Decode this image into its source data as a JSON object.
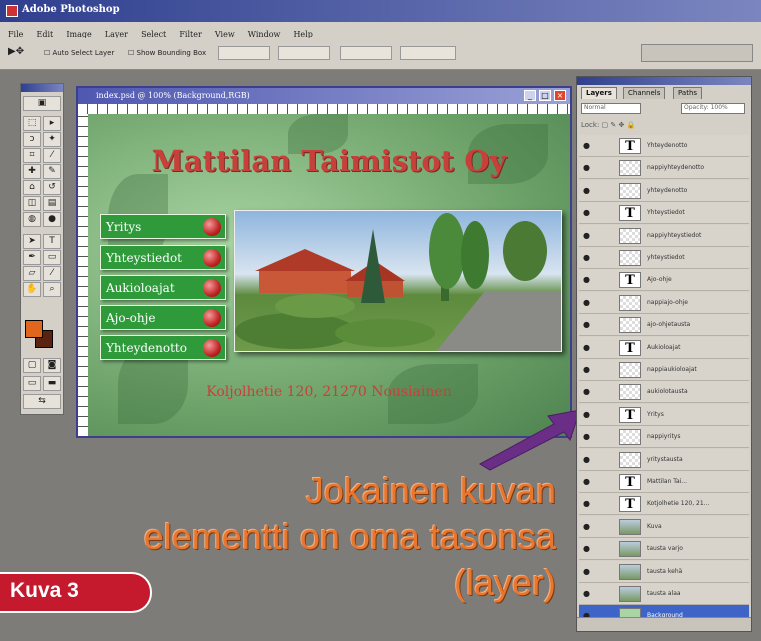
{
  "app": {
    "title": "Adobe Photoshop"
  },
  "menu": [
    "File",
    "Edit",
    "Image",
    "Layer",
    "Select",
    "Filter",
    "View",
    "Window",
    "Help"
  ],
  "options_bar": {
    "auto_select": "Auto Select Layer",
    "bounding_box": "Show Bounding Box"
  },
  "document": {
    "title": "index.psd @ 100% (Background,RGB)",
    "heading": "Mattilan Taimistot Oy",
    "nav": [
      "Yritys",
      "Yhteystiedot",
      "Aukioloajat",
      "Ajo-ohje",
      "Yhteydenotto"
    ],
    "address": "Koljolhetie 120, 21270 Nousiainen"
  },
  "layers_panel": {
    "tabs": [
      "Layers",
      "Channels",
      "Paths"
    ],
    "mode": "Normal",
    "opacity": "Opacity: 100%",
    "lock": "Lock:",
    "rows": [
      {
        "name": "Yhteydenotto",
        "type": "T"
      },
      {
        "name": "nappiyhteydenotto",
        "type": "px"
      },
      {
        "name": "yhteydenotto",
        "type": "px"
      },
      {
        "name": "Yhteystiedot",
        "type": "T"
      },
      {
        "name": "nappiyhteystiedot",
        "type": "px"
      },
      {
        "name": "yhteystiedot",
        "type": "px"
      },
      {
        "name": "Ajo-ohje",
        "type": "T"
      },
      {
        "name": "nappiajo-ohje",
        "type": "px"
      },
      {
        "name": "ajo-ohjetausta",
        "type": "px"
      },
      {
        "name": "Aukioloajat",
        "type": "T"
      },
      {
        "name": "nappiaukioloajat",
        "type": "px"
      },
      {
        "name": "aukiolotausta",
        "type": "px"
      },
      {
        "name": "Yritys",
        "type": "T"
      },
      {
        "name": "nappiyritys",
        "type": "px"
      },
      {
        "name": "yritystausta",
        "type": "px"
      },
      {
        "name": "Mattilan Tai...",
        "type": "T"
      },
      {
        "name": "Kotjolhetie 120, 21...",
        "type": "T"
      },
      {
        "name": "Kuva",
        "type": "img"
      },
      {
        "name": "tausta varjo",
        "type": "img"
      },
      {
        "name": "tausta kehä",
        "type": "img"
      },
      {
        "name": "tausta alaa",
        "type": "img"
      },
      {
        "name": "Background",
        "type": "bg",
        "selected": true
      }
    ]
  },
  "caption": {
    "line1": "Jokainen kuvan",
    "line2": "elementti on oma tasonsa",
    "line3": "(layer)"
  },
  "figure_label": "Kuva 3",
  "colors": {
    "foreground": "#e0661e",
    "background": "#5a2310",
    "accent_red": "#c5192d",
    "nav_green": "#2e9a3a"
  }
}
